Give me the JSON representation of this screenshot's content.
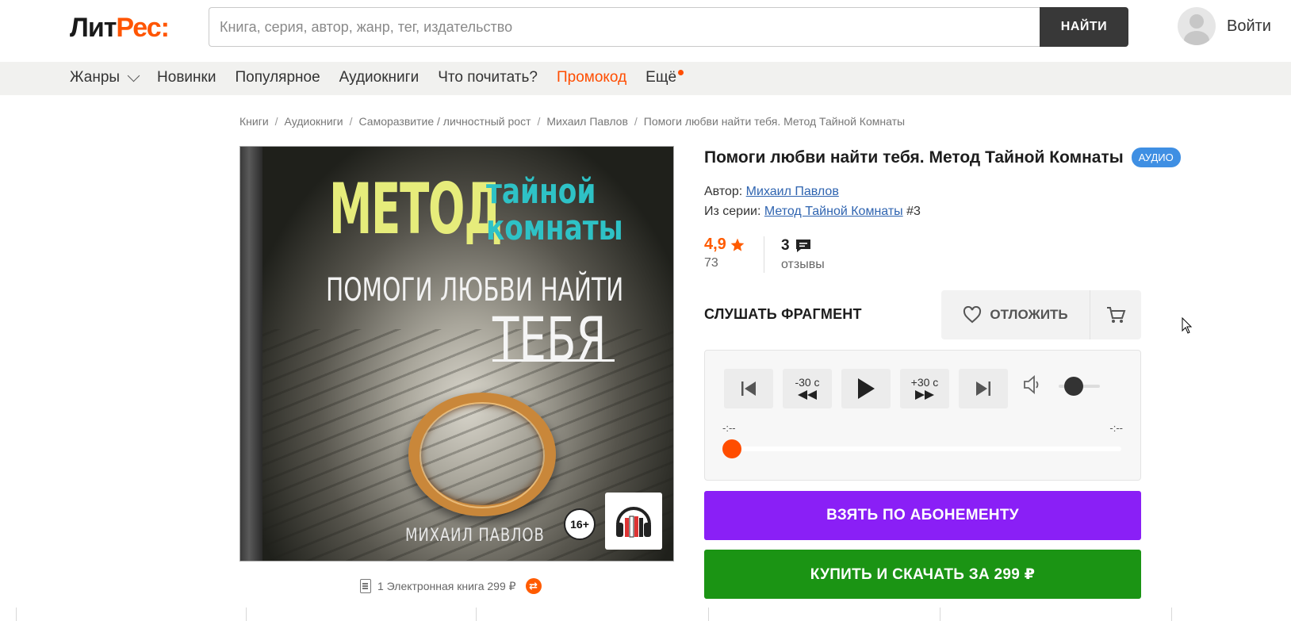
{
  "header": {
    "logo_part1": "Лит",
    "logo_part2": "Рес:",
    "search_placeholder": "Книга, серия, автор, жанр, тег, издательство",
    "search_button": "НАЙТИ",
    "login_label": "Войти"
  },
  "nav": {
    "genres": "Жанры",
    "new": "Новинки",
    "popular": "Популярное",
    "audiobooks": "Аудиокниги",
    "what_to_read": "Что почитать?",
    "promo": "Промокод",
    "more": "Ещё"
  },
  "breadcrumb": [
    "Книги",
    "Аудиокниги",
    "Саморазвитие / личностный рост",
    "Михаил Павлов",
    "Помоги любви найти тебя. Метод Тайной Комнаты"
  ],
  "cover": {
    "title_big": "МЕТОД",
    "title_teal_1": "тайной",
    "title_teal_2": "комнаты",
    "subtitle": "ПОМОГИ ЛЮБВИ НАЙТИ",
    "subtitle_big": "ТЕБЯ",
    "author": "МИХАИЛ ПАВЛОВ",
    "age_rating": "16+"
  },
  "ebook_link": "1 Электронная книга 299 ₽",
  "book": {
    "title": "Помоги любви найти тебя. Метод Тайной Комнаты",
    "badge": "АУДИО",
    "author_label": "Автор:",
    "author_name": "Михаил Павлов",
    "series_label": "Из серии:",
    "series_name": "Метод Тайной Комнаты",
    "series_number": "#3",
    "rating": "4,9",
    "rating_count": "73",
    "reviews_count": "3",
    "reviews_label": "отзывы"
  },
  "listen_label": "СЛУШАТЬ ФРАГМЕНТ",
  "defer_label": "ОТЛОЖИТЬ",
  "player": {
    "back_label": "-30 с",
    "forward_label": "+30 с",
    "time_current": "-:--",
    "time_total": "-:--",
    "volume": 0.1,
    "progress": 0
  },
  "subscribe_button": "ВЗЯТЬ ПО АБОНЕМЕНТУ",
  "buy_button": "КУПИТЬ И СКАЧАТЬ ЗА 299 ₽",
  "colors": {
    "accent": "#ff5500",
    "subscribe": "#8a1ff6",
    "buy": "#1b9414",
    "badge": "#3f8fe3",
    "link": "#2f64b0"
  }
}
